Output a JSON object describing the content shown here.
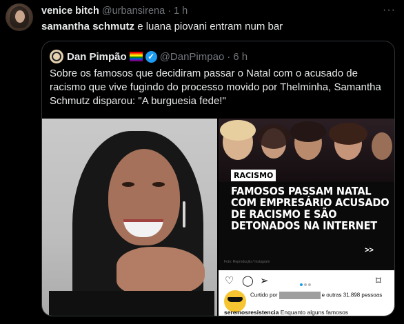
{
  "tweet": {
    "name": "venice bitch",
    "handle": "@urbansirena",
    "separator": "·",
    "time": "1 h",
    "more": "···",
    "text_bold": "samantha schmutz",
    "text_rest": " e luana piovani entram num bar"
  },
  "quote": {
    "name": "Dan Pimpão",
    "handle": "@DanPimpao",
    "separator": "·",
    "time": "6 h",
    "verified_icon": "✓",
    "text": "Sobre os famosos que decidiram passar o Natal com o acusado de racismo que vive fugindo do processo movido por Thelminha, Samantha Schmutz disparou: \"A burguesia fede!\"",
    "post_image": {
      "tag": "RACISMO",
      "headline": "FAMOSOS PASSAM NATAL COM EMPRESÁRIO ACUSADO DE RACISMO E SÃO DETONADOS NA INTERNET",
      "arrows": ">>",
      "credit": "Foto: Reprodução / Instagram",
      "icons": [
        "heart-icon",
        "comment-icon",
        "share-icon",
        "bookmark-icon"
      ],
      "liked_prefix": "Curtido por",
      "liked_suffix": "e outras 31.898 pessoas",
      "caption_user": "seremosresistencia",
      "caption_text": " Enquanto alguns famosos"
    }
  },
  "colors": {
    "background": "#000000",
    "text": "#e7e9ea",
    "muted": "#71767b",
    "border": "#2f3336",
    "verified": "#1d9bf0"
  }
}
